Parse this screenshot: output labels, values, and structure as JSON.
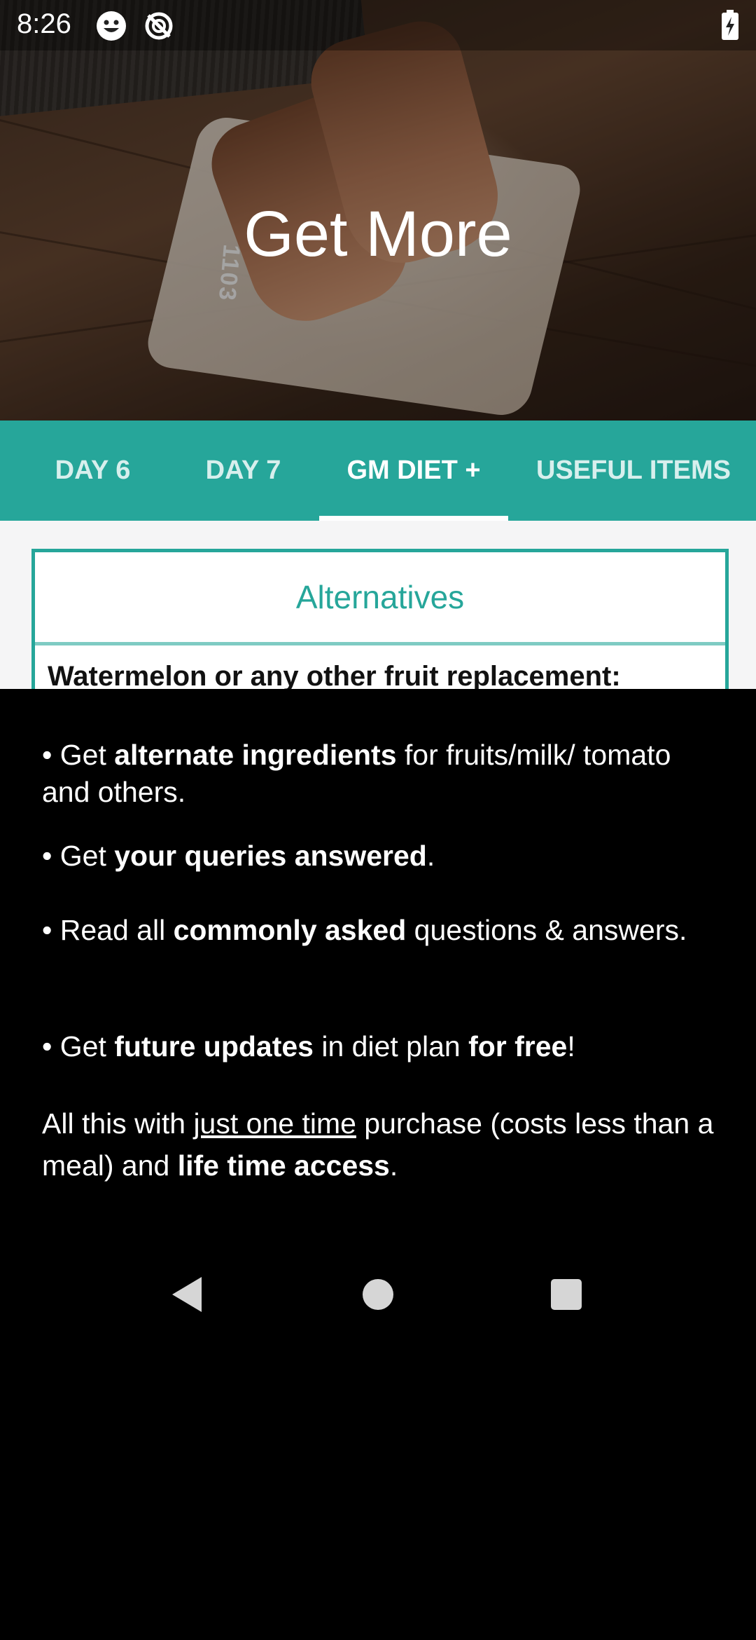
{
  "status_bar": {
    "time": "8:26",
    "icons": [
      "smiley-icon",
      "sync-disabled-icon",
      "battery-charging-icon"
    ]
  },
  "hero": {
    "title": "Get More",
    "scale_display": "1103"
  },
  "tabs": [
    {
      "label": "DAY 6",
      "active": false
    },
    {
      "label": "DAY 7",
      "active": false
    },
    {
      "label": "GM DIET +",
      "active": true
    },
    {
      "label": "USEFUL ITEMS",
      "active": false
    }
  ],
  "card": {
    "header": "Alternatives",
    "subheading": "Watermelon or any other fruit replacement:"
  },
  "promo": {
    "b1": {
      "pre": "• Get ",
      "bold": "alternate ingredients",
      "post": " for fruits/milk/ tomato and others."
    },
    "b2": {
      "pre": "• Get ",
      "bold": "your queries answered",
      "post": "."
    },
    "b3": {
      "pre": "• Read all ",
      "bold": "commonly asked",
      "post": " questions & answers."
    },
    "b4": {
      "pre": "• Get ",
      "bold": "future updates",
      "mid": " in diet plan ",
      "bold2": "for free",
      "post": "!"
    },
    "closing": {
      "pre": "All this with ",
      "underline": "just one time",
      "mid": " purchase (costs less than a meal) and ",
      "bold": "life time access",
      "post": "."
    }
  },
  "colors": {
    "accent": "#26a69a",
    "sheet_bg": "#000000"
  }
}
